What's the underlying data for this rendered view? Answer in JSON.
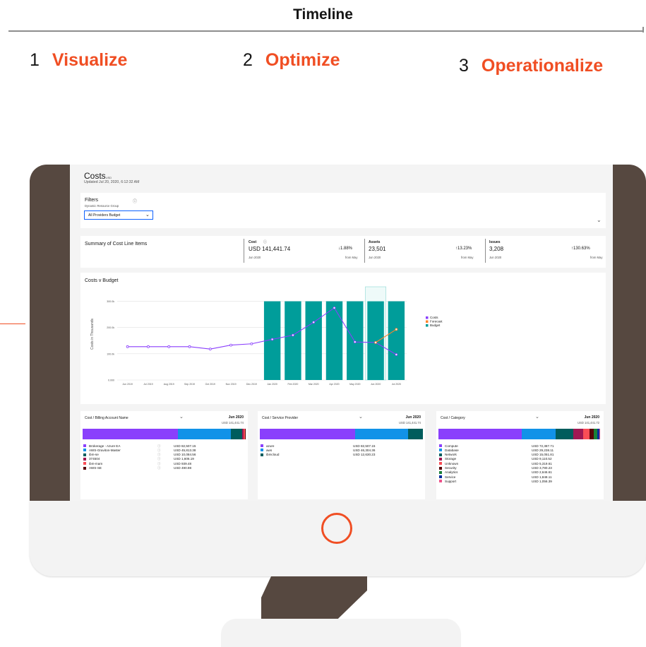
{
  "timeline": {
    "title": "Timeline",
    "steps": [
      {
        "num": "1",
        "label": "Visualize"
      },
      {
        "num": "2",
        "label": "Optimize"
      },
      {
        "num": "3",
        "label": "Operationalize"
      }
    ]
  },
  "colors": {
    "accent": "#f04e23",
    "monitor": "#564840",
    "purple": "#8a3ffc",
    "teal": "#009d9a",
    "orange": "#ff832b",
    "blue": "#1192e8"
  },
  "dashboard": {
    "title": "Costs",
    "title_suffix": "USD",
    "updated": "Updated Jul 20, 2020, 6:12:32 AM",
    "filters": {
      "title": "Filters",
      "subtitle": "Dynamic Resource Group",
      "info_icon": "info-icon",
      "dropdown_value": "All Providers Budget"
    },
    "summary": {
      "title": "Summary of Cost Line Items",
      "cost": {
        "label": "Cost",
        "value": "USD 141,441.74",
        "change": "↓1.88%",
        "date": "Jun 2020",
        "from": "from May"
      },
      "assets": {
        "label": "Assets",
        "value": "23,501",
        "change": "↑13.23%",
        "date": "Jun 2020",
        "from": "from May"
      },
      "issues": {
        "label": "Issues",
        "value": "3,208",
        "change": "↑130.63%",
        "date": "Jun 2020",
        "from": "from May"
      }
    },
    "panels": [
      {
        "title": "Cost / Billing Account Name",
        "month": "Jun 2020",
        "total": "USD 141,441.74",
        "items": [
          {
            "name": "Brokerage - Azure EA",
            "value": "USD 82,507.15",
            "color": "#8a3ffc",
            "share": 0.583
          },
          {
            "name": "AWS-Graviton-Master",
            "value": "USD 45,813.38",
            "color": "#1192e8",
            "share": 0.324
          },
          {
            "name": "ibm-se",
            "value": "USD 10,084.56",
            "color": "#005d5d",
            "share": 0.071
          },
          {
            "name": "374504",
            "value": "USD 1,606.19",
            "color": "#9f1853",
            "share": 0.011
          },
          {
            "name": "ibm-mam",
            "value": "USD 939.48",
            "color": "#fa4d56",
            "share": 0.007
          },
          {
            "name": "AWS-SE",
            "value": "USD 490.98",
            "color": "#570408",
            "share": 0.004
          }
        ]
      },
      {
        "title": "Cost / Service Provider",
        "month": "Jun 2020",
        "total": "USD 141,441.74",
        "items": [
          {
            "name": "azure",
            "value": "USD 82,507.15",
            "color": "#8a3ffc",
            "share": 0.583
          },
          {
            "name": "aws",
            "value": "USD 46,304.36",
            "color": "#1192e8",
            "share": 0.328
          },
          {
            "name": "ibmcloud",
            "value": "USD 12,630.23",
            "color": "#005d5d",
            "share": 0.089
          }
        ]
      },
      {
        "title": "Cost / Category",
        "month": "Jun 2020",
        "total": "USD 141,441.72",
        "items": [
          {
            "name": "Compute",
            "value": "USD 72,387.71",
            "color": "#8a3ffc",
            "share": 0.512
          },
          {
            "name": "Database",
            "value": "USD 29,238.11",
            "color": "#1192e8",
            "share": 0.207
          },
          {
            "name": "Network",
            "value": "USD 15,051.81",
            "color": "#005d5d",
            "share": 0.106
          },
          {
            "name": "Storage",
            "value": "USD 9,110.52",
            "color": "#9f1853",
            "share": 0.064
          },
          {
            "name": "Unknown",
            "value": "USD 5,319.61",
            "color": "#fa4d56",
            "share": 0.038
          },
          {
            "name": "Security",
            "value": "USD 3,780.23",
            "color": "#570408",
            "share": 0.027
          },
          {
            "name": "Analytics",
            "value": "USD 2,646.61",
            "color": "#198038",
            "share": 0.019
          },
          {
            "name": "Service",
            "value": "USD 1,848.11",
            "color": "#002d9c",
            "share": 0.013
          },
          {
            "name": "Support",
            "value": "USD 1,056.39",
            "color": "#ee538b",
            "share": 0.007
          }
        ]
      }
    ]
  },
  "chart_data": {
    "type": "bar",
    "title": "Costs v Budget",
    "ylabel": "Costs in Thousands",
    "xlabel": "",
    "categories": [
      "Jun 2019",
      "Jul 2019",
      "Aug 2019",
      "Sep 2019",
      "Oct 2019",
      "Nov 2019",
      "Dec 2019",
      "Jan 2020",
      "Feb 2020",
      "Mar 2020",
      "Apr 2020",
      "May 2020",
      "Jun 2020",
      "Jul 2020"
    ],
    "yticks": [
      {
        "value": 0,
        "label": "0.000"
      },
      {
        "value": 100,
        "label": "100.0k"
      },
      {
        "value": 200,
        "label": "200.0k"
      },
      {
        "value": 300,
        "label": "300.0k"
      }
    ],
    "ylim": [
      0,
      350
    ],
    "grid": true,
    "legend_position": "right",
    "highlight_category": "Jun 2020",
    "series": [
      {
        "name": "Costs",
        "type": "line",
        "color": "#8a3ffc",
        "values": [
          127,
          127,
          127,
          127,
          118,
          133,
          138,
          155,
          171,
          220,
          275,
          145,
          143,
          97
        ]
      },
      {
        "name": "Forecast",
        "type": "line",
        "color": "#ff832b",
        "values": [
          null,
          null,
          null,
          null,
          null,
          null,
          null,
          null,
          null,
          null,
          null,
          null,
          143,
          193
        ]
      },
      {
        "name": "Budget",
        "type": "bar",
        "color": "#009d9a",
        "values": [
          null,
          null,
          null,
          null,
          null,
          null,
          null,
          300,
          300,
          300,
          300,
          300,
          300,
          300
        ]
      }
    ]
  }
}
